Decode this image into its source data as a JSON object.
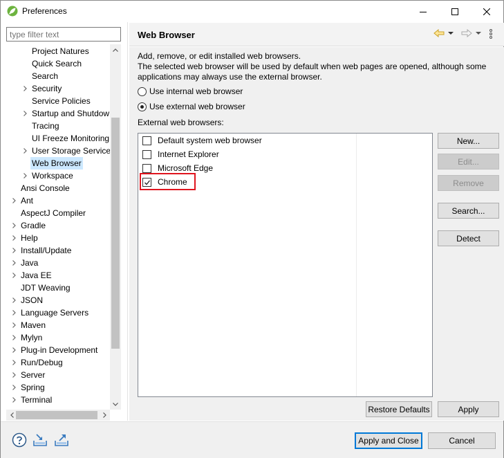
{
  "window": {
    "title": "Preferences",
    "icon": "spring-leaf-icon",
    "accent_color": "#6db33f"
  },
  "filter": {
    "placeholder": "type filter text"
  },
  "tree": {
    "items": [
      {
        "label": "Project Natures",
        "level": 1,
        "expandable": false
      },
      {
        "label": "Quick Search",
        "level": 1,
        "expandable": false
      },
      {
        "label": "Search",
        "level": 1,
        "expandable": false
      },
      {
        "label": "Security",
        "level": 1,
        "expandable": true
      },
      {
        "label": "Service Policies",
        "level": 1,
        "expandable": false
      },
      {
        "label": "Startup and Shutdown",
        "level": 1,
        "expandable": true
      },
      {
        "label": "Tracing",
        "level": 1,
        "expandable": false
      },
      {
        "label": "UI Freeze Monitoring",
        "level": 1,
        "expandable": false
      },
      {
        "label": "User Storage Service",
        "level": 1,
        "expandable": true
      },
      {
        "label": "Web Browser",
        "level": 1,
        "expandable": false,
        "selected": true
      },
      {
        "label": "Workspace",
        "level": 1,
        "expandable": true
      },
      {
        "label": "Ansi Console",
        "level": 0,
        "expandable": false
      },
      {
        "label": "Ant",
        "level": 0,
        "expandable": true
      },
      {
        "label": "AspectJ Compiler",
        "level": 0,
        "expandable": false
      },
      {
        "label": "Gradle",
        "level": 0,
        "expandable": true
      },
      {
        "label": "Help",
        "level": 0,
        "expandable": true
      },
      {
        "label": "Install/Update",
        "level": 0,
        "expandable": true
      },
      {
        "label": "Java",
        "level": 0,
        "expandable": true
      },
      {
        "label": "Java EE",
        "level": 0,
        "expandable": true
      },
      {
        "label": "JDT Weaving",
        "level": 0,
        "expandable": false
      },
      {
        "label": "JSON",
        "level": 0,
        "expandable": true
      },
      {
        "label": "Language Servers",
        "level": 0,
        "expandable": true
      },
      {
        "label": "Maven",
        "level": 0,
        "expandable": true
      },
      {
        "label": "Mylyn",
        "level": 0,
        "expandable": true
      },
      {
        "label": "Plug-in Development",
        "level": 0,
        "expandable": true
      },
      {
        "label": "Run/Debug",
        "level": 0,
        "expandable": true
      },
      {
        "label": "Server",
        "level": 0,
        "expandable": true
      },
      {
        "label": "Spring",
        "level": 0,
        "expandable": true
      },
      {
        "label": "Terminal",
        "level": 0,
        "expandable": true
      }
    ]
  },
  "page": {
    "title": "Web Browser",
    "description_lines": [
      "Add, remove, or edit installed web browsers.",
      "The selected web browser will be used by default when web pages are opened, although some",
      "applications may always use the external browser."
    ],
    "radio_internal": "Use internal web browser",
    "radio_external": "Use external web browser",
    "selected_mode": "external",
    "list_label": "External web browsers:",
    "browsers": [
      {
        "name": "Default system web browser",
        "checked": false
      },
      {
        "name": "Internet Explorer",
        "checked": false
      },
      {
        "name": "Microsoft Edge",
        "checked": false
      },
      {
        "name": "Chrome",
        "checked": true,
        "highlighted": true
      }
    ],
    "highlight_color": "#e0141e",
    "buttons": {
      "new": "New...",
      "edit": "Edit...",
      "remove": "Remove",
      "search": "Search...",
      "detect": "Detect",
      "restore_defaults": "Restore Defaults",
      "apply": "Apply"
    }
  },
  "footer": {
    "apply_and_close": "Apply and Close",
    "cancel": "Cancel",
    "icons": [
      "help-icon",
      "import-icon",
      "export-icon"
    ],
    "default_button_color": "#0078d7"
  }
}
